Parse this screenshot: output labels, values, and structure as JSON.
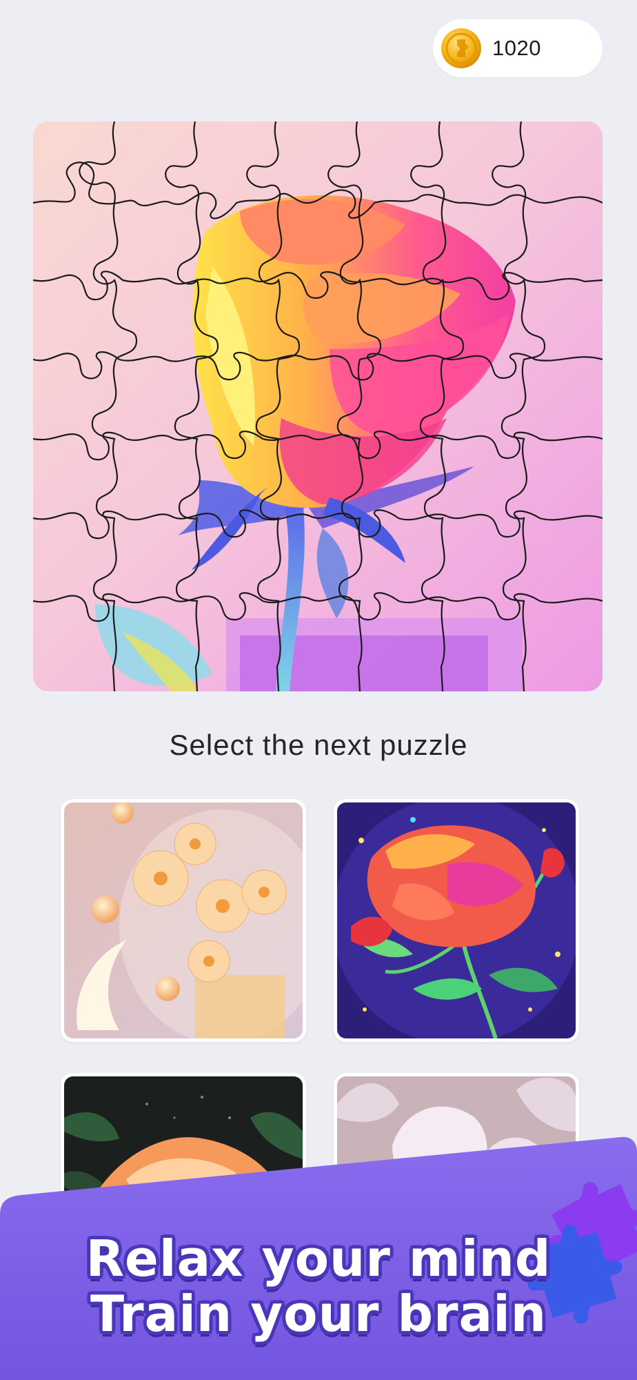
{
  "header": {
    "coin_count": "1020",
    "coin_icon": "gold-coin-puzzle-icon"
  },
  "board": {
    "image": "rose-puzzle-artwork",
    "grid": "jigsaw pieces outline"
  },
  "select": {
    "title": "Select the next puzzle"
  },
  "thumbnails": [
    {
      "name": "daisies-in-glass-jar"
    },
    {
      "name": "stained-glass-rose-night"
    },
    {
      "name": "orange-peony-dark"
    },
    {
      "name": "white-tulips"
    }
  ],
  "promo": {
    "line1": "Relax your mind",
    "line2": "Train your brain",
    "icon": "jigsaw-pieces-icon"
  },
  "colors": {
    "background": "#ECEEF3",
    "banner": "#7A5CE6",
    "banner_text_outline": "#4A36B8",
    "coin": "#F7B61C"
  }
}
